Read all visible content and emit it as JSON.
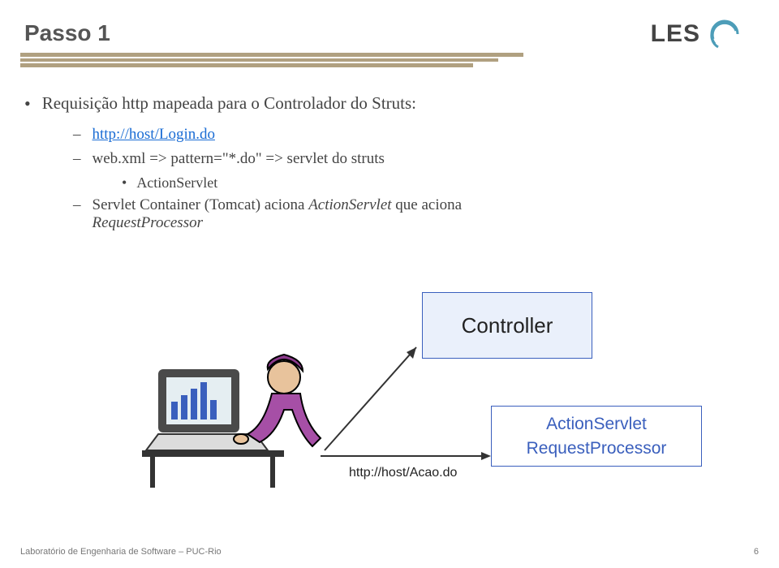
{
  "page_title": "Passo 1",
  "logo_text": "LES",
  "bullet1": "Requisição http mapeada para o Controlador do Struts:",
  "b2_link": "http://host/Login.do",
  "b2_line2_a": "web.xml => pattern=\"*.do\" => servlet do struts",
  "b3_actionservlet": "ActionServlet",
  "b2_line3_a": "Servlet Container (Tomcat) aciona ",
  "b2_line3_b": "ActionServlet",
  "b2_line3_c": " que aciona ",
  "b2_line3_d": "RequestProcessor",
  "controller_label": "Controller",
  "action_line1": "ActionServlet",
  "action_line2": "RequestProcessor",
  "diagram_url": "http://host/Acao.do",
  "footer_left": "Laboratório de Engenharia de Software – PUC-Rio",
  "footer_right": "6"
}
